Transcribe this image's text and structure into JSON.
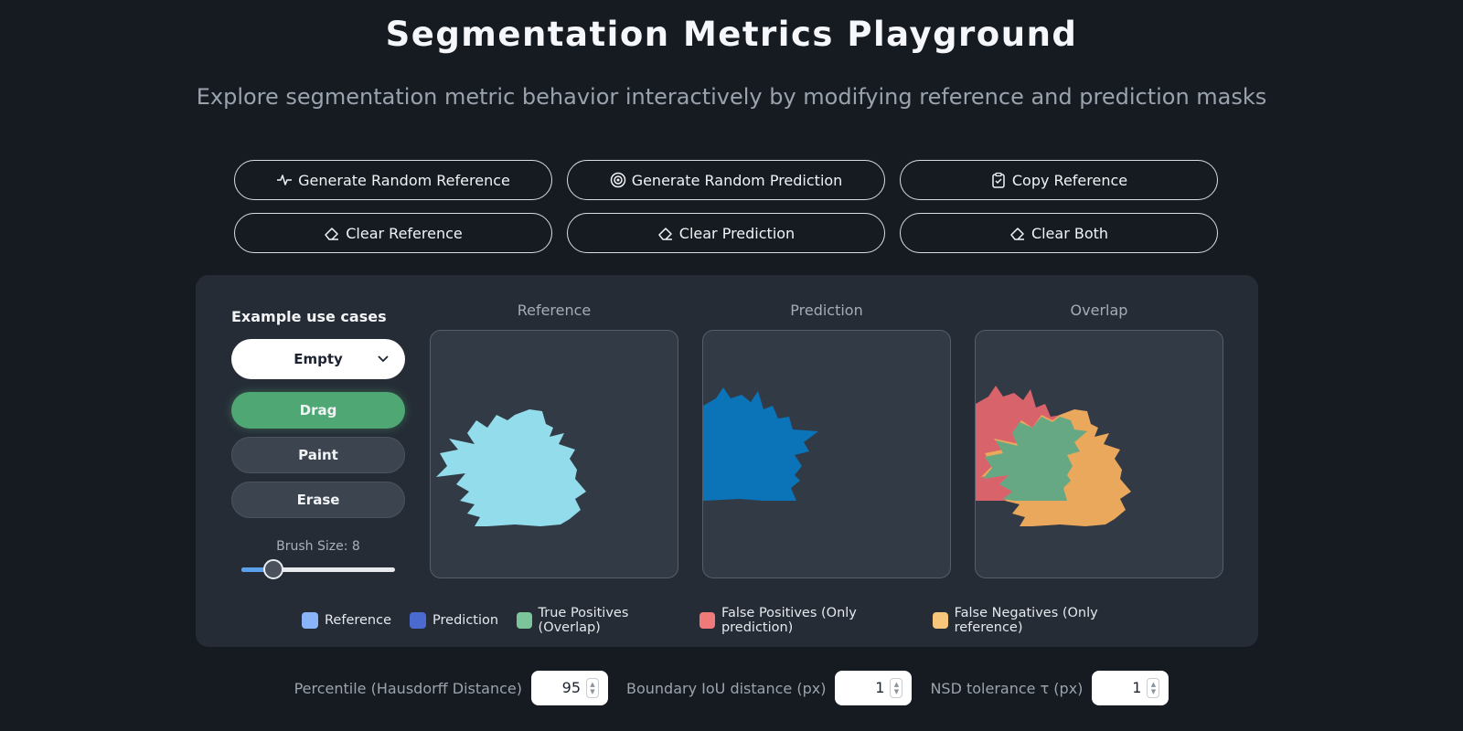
{
  "header": {
    "title": "Segmentation Metrics Playground",
    "subtitle": "Explore segmentation metric behavior interactively by modifying reference and prediction masks"
  },
  "actions": {
    "generate_reference": "Generate Random Reference",
    "generate_prediction": "Generate Random Prediction",
    "copy_reference": "Copy Reference",
    "clear_reference": "Clear Reference",
    "clear_prediction": "Clear Prediction",
    "clear_both": "Clear Both"
  },
  "sidebar": {
    "title": "Example use cases",
    "example_selected": "Empty",
    "modes": {
      "drag": "Drag",
      "paint": "Paint",
      "erase": "Erase",
      "active": "Drag"
    },
    "brush_label": "Brush Size: 8",
    "brush_size": 8,
    "brush_max": 50
  },
  "canvases": {
    "reference_label": "Reference",
    "prediction_label": "Prediction",
    "overlap_label": "Overlap"
  },
  "legend": [
    {
      "label": "Reference",
      "color": "#8ab4f8"
    },
    {
      "label": "Prediction",
      "color": "#4a6ad0"
    },
    {
      "label": "True Positives (Overlap)",
      "color": "#7cc49a"
    },
    {
      "label": "False Positives (Only prediction)",
      "color": "#f07a7a"
    },
    {
      "label": "False Negatives (Only reference)",
      "color": "#f7c67a"
    }
  ],
  "colors": {
    "reference_mask": "#93dcec",
    "prediction_mask": "#0b73b8",
    "true_positive": "#66a884",
    "false_positive": "#d9636b",
    "false_negative": "#e9a85c",
    "accent": "#4fa874"
  },
  "params": {
    "percentile_label": "Percentile (Hausdorff Distance)",
    "percentile_value": "95",
    "boundary_iou_label": "Boundary IoU distance (px)",
    "boundary_iou_value": "1",
    "nsd_label": "NSD tolerance τ (px)",
    "nsd_value": "1"
  }
}
